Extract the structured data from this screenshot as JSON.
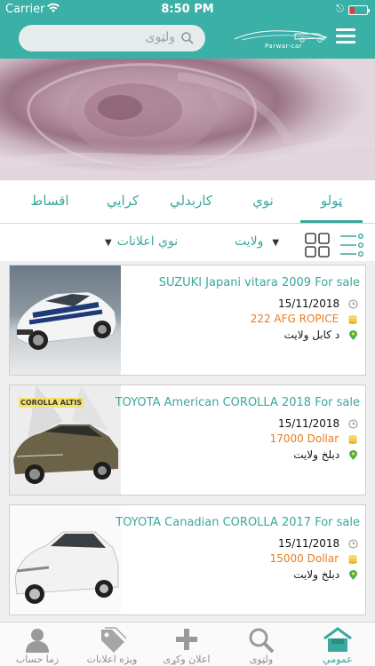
{
  "status_bar": {
    "carrier": "Carrier",
    "time": "8:50 PM"
  },
  "header": {
    "search_placeholder": "ولټوی",
    "logo_text": "Parwar-car"
  },
  "tabs": [
    {
      "label": "ټولو",
      "active": true
    },
    {
      "label": "نوي",
      "active": false
    },
    {
      "label": "کاربدلي",
      "active": false
    },
    {
      "label": "کرايي",
      "active": false
    },
    {
      "label": "اقساط",
      "active": false
    }
  ],
  "filters": {
    "province": "ولایت",
    "ad_type": "نوي اعلانات"
  },
  "listings": [
    {
      "title": "SUZUKI Japani vitara 2009 For sale",
      "date": "15/11/2018",
      "price": "222 AFG ROPICE",
      "location": "د کابل ولایت",
      "image": "white-sports-car"
    },
    {
      "title": "TOYOTA American  COROLLA  2018 For sale",
      "date": "15/11/2018",
      "price": "17000 Dollar",
      "location": "دبلخ ولایت",
      "image": "bronze-corolla",
      "image_caption": "COROLLA ALTIS"
    },
    {
      "title": "TOYOTA  Canadian  COROLLA  2017 For sale",
      "date": "15/11/2018",
      "price": "15000 Dollar",
      "location": "دبلخ ولایت",
      "image": "white-corolla"
    }
  ],
  "bottom_nav": [
    {
      "label": "عمومي",
      "icon": "home-icon",
      "active": true
    },
    {
      "label": "ولټوی",
      "icon": "search-icon",
      "active": false
    },
    {
      "label": "اعلان وکړی",
      "icon": "plus-icon",
      "active": false
    },
    {
      "label": "ويژه اعلانات",
      "icon": "tag-icon",
      "active": false
    },
    {
      "label": "زما حساب",
      "icon": "person-icon",
      "active": false
    }
  ],
  "colors": {
    "accent": "#3aa89d",
    "header": "#3bb0a6",
    "price": "#e67e22"
  }
}
